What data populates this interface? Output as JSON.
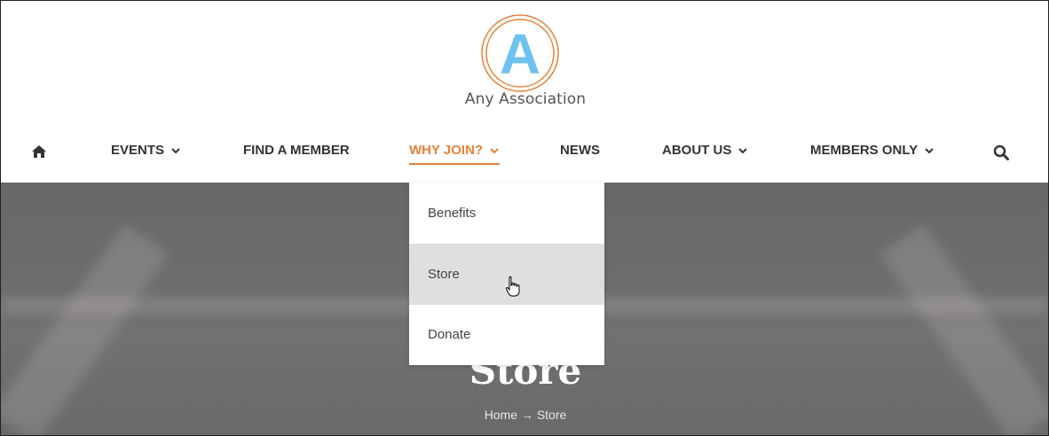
{
  "brand": {
    "logo_letter": "A",
    "name": "Any Association",
    "logo_ring_color": "#e8803a",
    "logo_letter_color": "#6ec2f0"
  },
  "nav": {
    "home_icon": "home-icon",
    "items": [
      {
        "label": "EVENTS",
        "has_dropdown": true
      },
      {
        "label": "FIND A MEMBER",
        "has_dropdown": false
      },
      {
        "label": "WHY JOIN?",
        "has_dropdown": true,
        "active": true
      },
      {
        "label": "NEWS",
        "has_dropdown": false
      },
      {
        "label": "ABOUT US",
        "has_dropdown": true
      },
      {
        "label": "MEMBERS ONLY",
        "has_dropdown": true
      }
    ],
    "search_icon": "search-icon",
    "active_color": "#e8803a"
  },
  "dropdown": {
    "items": [
      {
        "label": "Benefits"
      },
      {
        "label": "Store",
        "hovered": true
      },
      {
        "label": "Donate"
      }
    ]
  },
  "hero": {
    "title": "Store",
    "breadcrumb": {
      "home": "Home",
      "separator": "→",
      "current": "Store"
    }
  }
}
